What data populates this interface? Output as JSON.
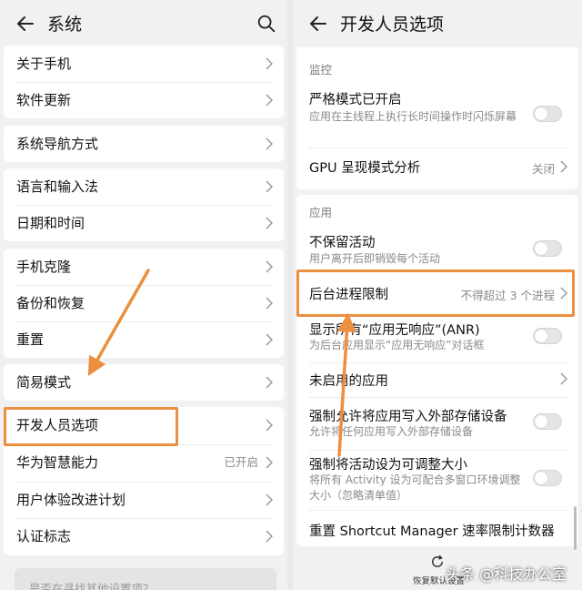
{
  "left": {
    "title": "系统",
    "items": [
      {
        "label": "关于手机"
      },
      {
        "label": "软件更新"
      },
      {
        "label": "系统导航方式"
      },
      {
        "label": "语言和输入法"
      },
      {
        "label": "日期和时间"
      },
      {
        "label": "手机克隆"
      },
      {
        "label": "备份和恢复"
      },
      {
        "label": "重置"
      },
      {
        "label": "简易模式"
      },
      {
        "label": "开发人员选项"
      },
      {
        "label": "华为智慧能力",
        "value": "已开启"
      },
      {
        "label": "用户体验改进计划"
      },
      {
        "label": "认证标志"
      }
    ],
    "footer_hint": "是否在寻找其他设置项？"
  },
  "right": {
    "title": "开发人员选项",
    "section_monitor": "监控",
    "strict_mode": {
      "title": "严格模式已开启",
      "desc": "应用在主线程上执行长时间操作时闪烁屏幕"
    },
    "gpu_render": {
      "title": "GPU 呈现模式分析",
      "value": "关闭"
    },
    "section_apps": "应用",
    "dont_keep": {
      "title": "不保留活动",
      "desc": "用户离开后即销毁每个活动"
    },
    "bg_limit": {
      "title": "后台进程限制",
      "value": "不得超过 3 个进程"
    },
    "anr": {
      "title": "显示所有“应用无响应”(ANR)",
      "desc": "为后台应用显示“应用无响应”对话框"
    },
    "inactive_apps": {
      "title": "未启用的应用"
    },
    "force_external": {
      "title": "强制允许将应用写入外部存储设备",
      "desc": "允许将任何应用写入外部存储设备"
    },
    "force_resizable": {
      "title": "强制将活动设为可调整大小",
      "desc": "将所有 Activity 设为可配合多窗口环境调整大小（忽略清单值）"
    },
    "reset_shortcut": {
      "title": "重置 Shortcut Manager 速率限制计数器"
    },
    "restore_defaults": "恢复默认设置"
  },
  "watermark": "头条 @科技办公室",
  "colors": {
    "highlight": "#ec8f3e",
    "background": "#f1f1f3",
    "card": "#ffffff",
    "secondary_text": "#8a8a8a"
  }
}
